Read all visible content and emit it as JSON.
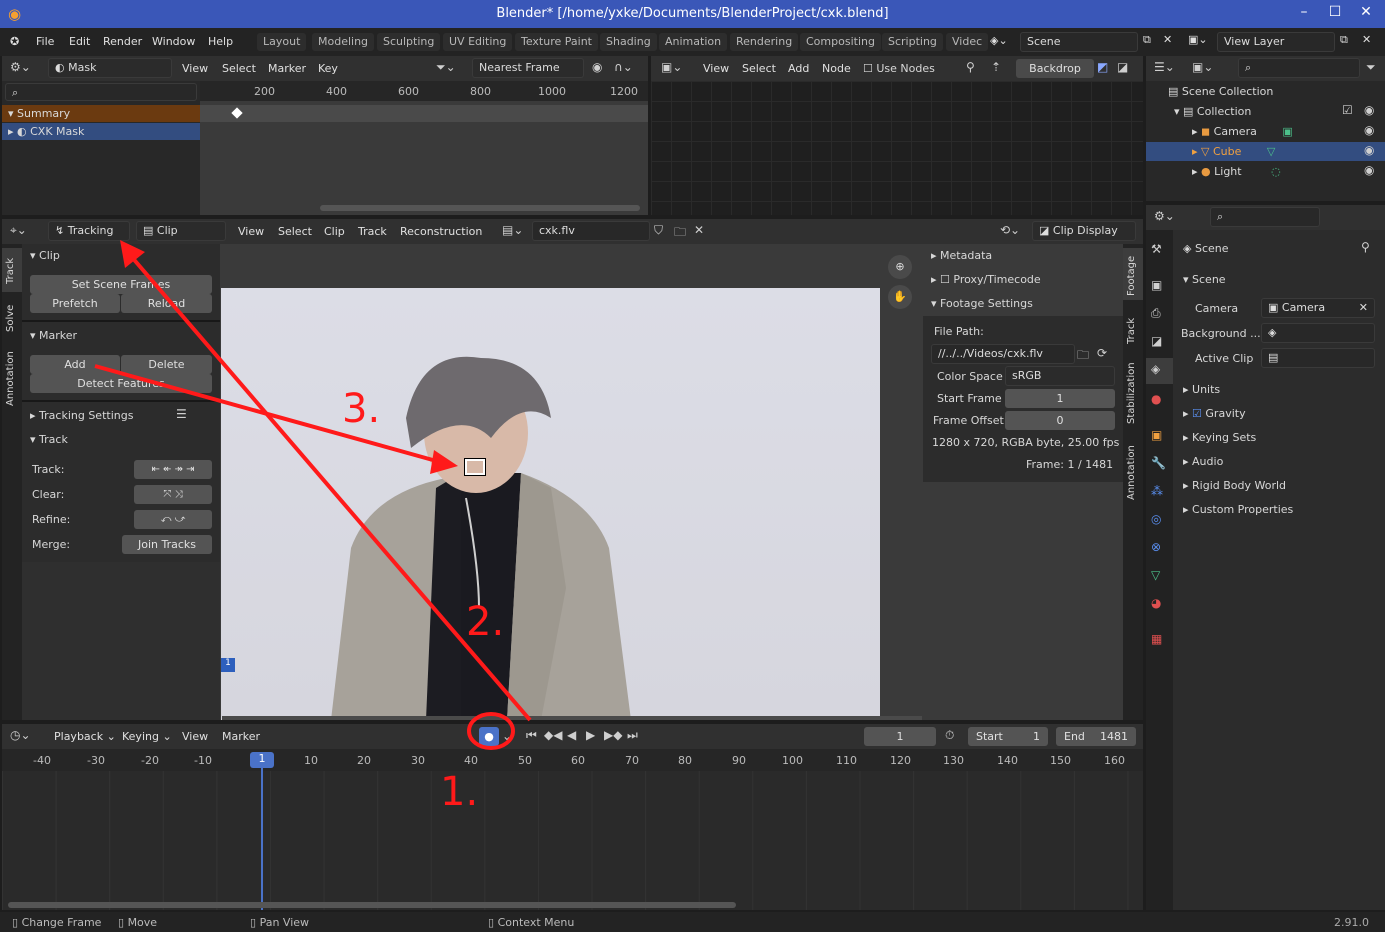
{
  "title": "Blender* [/home/yxke/Documents/BlenderProject/cxk.blend]",
  "menu": {
    "items": [
      "File",
      "Edit",
      "Render",
      "Window",
      "Help"
    ]
  },
  "workspaces": [
    "Layout",
    "Modeling",
    "Sculpting",
    "UV Editing",
    "Texture Paint",
    "Shading",
    "Animation",
    "Rendering",
    "Compositing",
    "Scripting",
    "Videc"
  ],
  "scene_field": "Scene",
  "viewlayer_field": "View Layer",
  "dopesheet": {
    "mode": "Mask",
    "menus": [
      "View",
      "Select",
      "Marker",
      "Key"
    ],
    "snap": "Nearest Frame",
    "ruler": [
      "200",
      "400",
      "600",
      "800",
      "1000",
      "1200"
    ],
    "channels": [
      "Summary",
      "CXK Mask"
    ]
  },
  "node": {
    "menus": [
      "View",
      "Select",
      "Add",
      "Node"
    ],
    "use_nodes": "Use Nodes",
    "backdrop": "Backdrop"
  },
  "outliner": {
    "root": "Scene Collection",
    "collection": "Collection",
    "items": [
      "Camera",
      "Cube",
      "Light"
    ]
  },
  "clip": {
    "mode": "Tracking",
    "view": "Clip",
    "menus": [
      "View",
      "Select",
      "Clip",
      "Track",
      "Reconstruction"
    ],
    "file": "cxk.flv",
    "display": "Clip Display"
  },
  "toolpanel": {
    "tabs": [
      "Track",
      "Solve",
      "Annotation"
    ],
    "clip_header": "Clip",
    "set_scene_frames": "Set Scene Frames",
    "prefetch": "Prefetch",
    "reload": "Reload",
    "marker_header": "Marker",
    "add": "Add",
    "delete": "Delete",
    "detect": "Detect Features",
    "tracking_settings": "Tracking Settings",
    "track_header": "Track",
    "rows": [
      "Track:",
      "Clear:",
      "Refine:",
      "Merge:"
    ],
    "join": "Join Tracks"
  },
  "footage": {
    "metadata": "Metadata",
    "proxy": "Proxy/Timecode",
    "settings": "Footage Settings",
    "file_path_label": "File Path:",
    "file_path": "//../../Videos/cxk.flv",
    "color_space_label": "Color Space",
    "color_space": "sRGB",
    "start_frame_label": "Start Frame",
    "start_frame": "1",
    "frame_offset_label": "Frame Offset",
    "frame_offset": "0",
    "info": "1280 x 720, RGBA byte, 25.00 fps",
    "frame": "Frame: 1 / 1481",
    "tabs": [
      "Footage",
      "Track",
      "Stabilization",
      "Annotation"
    ]
  },
  "properties": {
    "scene_tab": "Scene",
    "scene_header": "Scene",
    "camera_label": "Camera",
    "camera": "Camera",
    "background_label": "Background ...",
    "active_clip_label": "Active Clip",
    "sections": [
      "Units",
      "Gravity",
      "Keying Sets",
      "Audio",
      "Rigid Body World",
      "Custom Properties"
    ]
  },
  "timeline": {
    "menus": [
      "Playback",
      "Keying",
      "View",
      "Marker"
    ],
    "current": "1",
    "start_label": "Start",
    "start": "1",
    "end_label": "End",
    "end": "1481",
    "ruler": [
      "-40",
      "-30",
      "-20",
      "-10",
      "1",
      "10",
      "20",
      "30",
      "40",
      "50",
      "60",
      "70",
      "80",
      "90",
      "100",
      "110",
      "120",
      "130",
      "140",
      "150",
      "160"
    ]
  },
  "status": {
    "change_frame": "Change Frame",
    "move": "Move",
    "pan_view": "Pan View",
    "context_menu": "Context Menu",
    "version": "2.91.0"
  },
  "annotations": {
    "a1": "1.",
    "a2": "2.",
    "a3": "3."
  },
  "colors": {
    "accent": "#3a57b8",
    "selected_row": "#334d80",
    "summary_row": "#6b3a10",
    "annotation": "#ff1a1a"
  }
}
